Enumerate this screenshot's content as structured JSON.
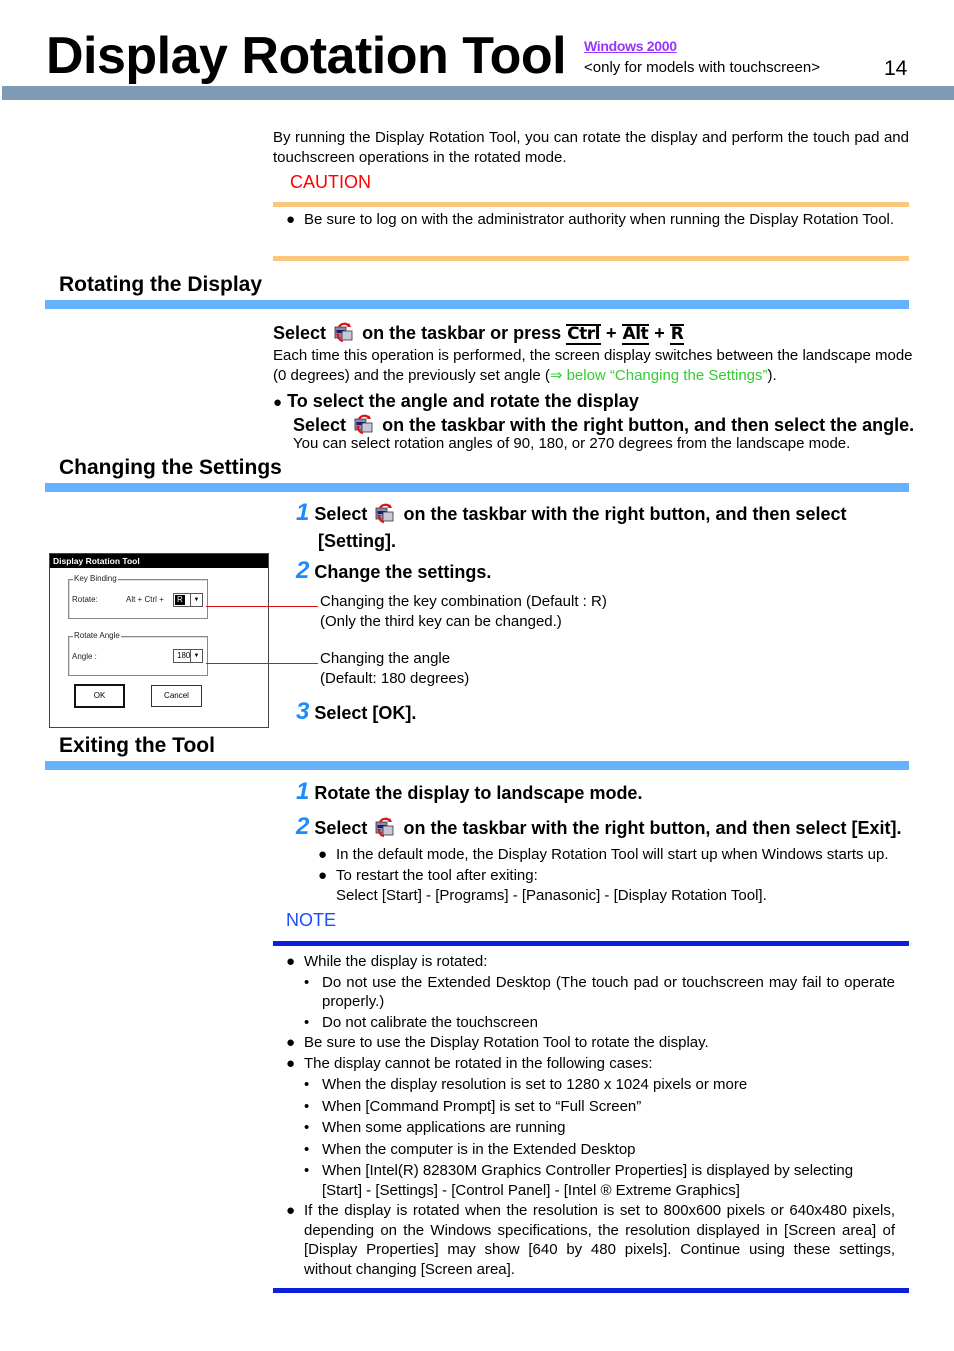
{
  "header": {
    "title": "Display Rotation Tool",
    "os_label": "Windows 2000",
    "models_note": "<only for models with touchscreen>",
    "page_number": "14"
  },
  "intro": "By running the Display Rotation Tool, you can rotate the display and perform the touch pad and touchscreen operations in the rotated mode.",
  "caution": {
    "label": "CAUTION",
    "items": [
      "Be sure to log on with the administrator authority when running the Display Rotation Tool."
    ]
  },
  "rotating": {
    "title": "Rotating the Display",
    "instruction_pre": "Select",
    "instruction_mid": "on the taskbar or press",
    "keys": [
      "Ctrl",
      "Alt",
      "R"
    ],
    "key_separator": "+",
    "description_pre": "Each time this operation is performed, the screen display switches between the landscape mode (0 degrees) and the previously set angle (",
    "description_link": "⇒ below “Changing the Settings”",
    "description_post": ").",
    "sub_heading": "To select the angle and rotate the display",
    "sub_instruction_pre": "Select",
    "sub_instruction_post": "on the taskbar with the right button, and then select the angle.",
    "sub_description": "You can select rotation angles of 90, 180, or 270 degrees from the landscape mode."
  },
  "changing": {
    "title": "Changing the Settings",
    "steps": [
      {
        "num": "1",
        "pre": "Select",
        "post": "on the taskbar with the right button, and then select",
        "line2": "[Setting]."
      },
      {
        "num": "2",
        "text": "Change the settings."
      },
      {
        "num": "3",
        "text": "Select [OK]."
      }
    ],
    "callouts": [
      {
        "line1": "Changing the key combination (Default : R)",
        "line2": "(Only the third key can be changed.)"
      },
      {
        "line1": "Changing the angle",
        "line2": "(Default: 180 degrees)"
      }
    ],
    "dialog": {
      "title": "Display Rotation Tool",
      "key_binding_group": "Key Binding",
      "rotate_label": "Rotate:",
      "modifier_text": "Alt + Ctrl +",
      "key_value": "R",
      "rotate_angle_group": "Rotate Angle",
      "angle_label": "Angle :",
      "angle_value": "180",
      "ok_label": "OK",
      "cancel_label": "Cancel"
    }
  },
  "exiting": {
    "title": "Exiting the Tool",
    "steps": [
      {
        "num": "1",
        "text": "Rotate the display to landscape mode."
      },
      {
        "num": "2",
        "pre": "Select",
        "post": "on the taskbar with the right button, and then select [Exit]."
      }
    ],
    "bullets": [
      "In the default mode, the Display Rotation Tool will start up when Windows starts up.",
      "To restart the tool after exiting:"
    ],
    "restart_path": "Select [Start] - [Programs] - [Panasonic] - [Display Rotation Tool]."
  },
  "note": {
    "label": "NOTE",
    "item1": "While the display is rotated:",
    "item1_subs": [
      "Do not use the Extended Desktop (The touch pad or touchscreen may fail to operate properly.)",
      "Do not calibrate the touchscreen"
    ],
    "item2": "Be sure to use the Display Rotation Tool to rotate the display.",
    "item3": "The display cannot be rotated in the following cases:",
    "item3_subs": [
      "When the display resolution is set to 1280 x 1024 pixels or more",
      "When [Command Prompt] is set to “Full Screen”",
      "When some applications are running",
      "When the computer is in the Extended Desktop",
      "When [Intel(R) 82830M Graphics Controller Properties] is displayed by selecting [Start] - [Settings] - [Control Panel] - [Intel ® Extreme Graphics]"
    ],
    "item4": "If the display is rotated when the resolution is set to 800x600 pixels or 640x480 pixels, depending on the Windows specifications, the resolution displayed in [Screen area] of [Display Properties] may show [640 by 480 pixels].  Continue using these settings, without changing [Screen area]."
  },
  "glyphs": {
    "bullet": "●",
    "sub_bullet": "•",
    "dropdown_arrow": "▼"
  },
  "colors": {
    "banner": "#7f9ab4",
    "section_bar": "#66b2ff",
    "caution": "#ff0000",
    "caution_bar": "#fac77d",
    "note": "#1a4dff",
    "note_bar": "#0a1fe0",
    "step_number": "#1a8cff",
    "os_link": "#9933ff",
    "cross_ref": "#33cc33"
  }
}
